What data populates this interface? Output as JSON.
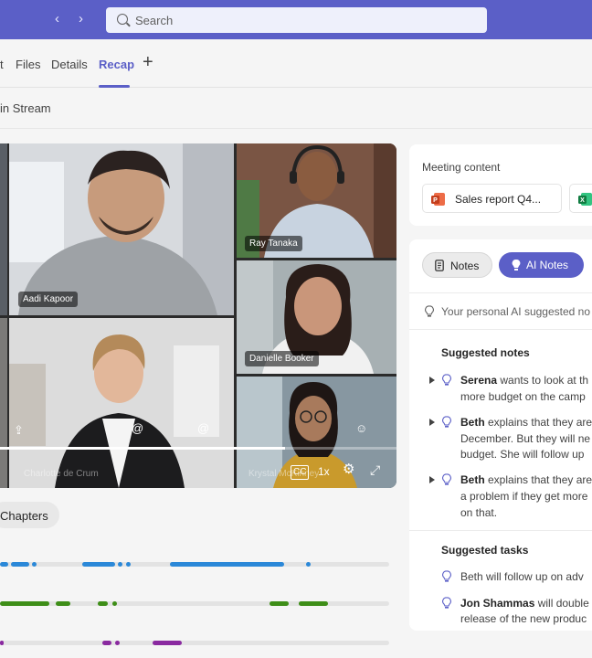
{
  "search": {
    "placeholder": "Search"
  },
  "nav": {
    "back": "‹",
    "forward": "›"
  },
  "tabs": [
    {
      "label": "t"
    },
    {
      "label": "Files"
    },
    {
      "label": "Details"
    },
    {
      "label": "Recap"
    }
  ],
  "tab_add": "+",
  "open_stream": "in Stream",
  "participants": [
    {
      "name": "Aadi Kapoor"
    },
    {
      "name": "Ray Tanaka"
    },
    {
      "name": "Danielle Booker"
    },
    {
      "name": "Charlotte de Crum"
    },
    {
      "name": "Krystal McKinney"
    }
  ],
  "playback": {
    "captions": "CC",
    "speed": "1x",
    "progress_fraction": 0.72
  },
  "chapters_label": "Chapters",
  "timeline": {
    "colors": [
      "#2b88d8",
      "#3e8e18",
      "#8a2aa0"
    ]
  },
  "meeting_content": {
    "title": "Meeting content",
    "files": [
      {
        "name": "Sales report Q4..."
      }
    ]
  },
  "notes_tabs": {
    "notes": "Notes",
    "ai_notes": "AI Notes"
  },
  "ai_hint": "Your personal AI suggested no",
  "suggested_notes": {
    "title": "Suggested notes",
    "items": [
      {
        "speaker": "Serena",
        "line1": " wants to look at th",
        "line2": "more budget on the camp"
      },
      {
        "speaker": "Beth",
        "line1": " explains that they are",
        "line2": "December. But they will ne",
        "line3": "budget. She will follow up"
      },
      {
        "speaker": "Beth",
        "line1": " explains that they are",
        "line2": "a problem if they get more",
        "line3": "on that."
      }
    ]
  },
  "suggested_tasks": {
    "title": "Suggested tasks",
    "items": [
      {
        "line1": "Beth will follow up on adv"
      },
      {
        "speaker": "Jon Shammas",
        "line1": " will double",
        "line2": "release of the new produc"
      }
    ]
  },
  "colors": {
    "brand": "#5b5fc7",
    "panel": "#ffffff",
    "background": "#f5f5f5"
  }
}
